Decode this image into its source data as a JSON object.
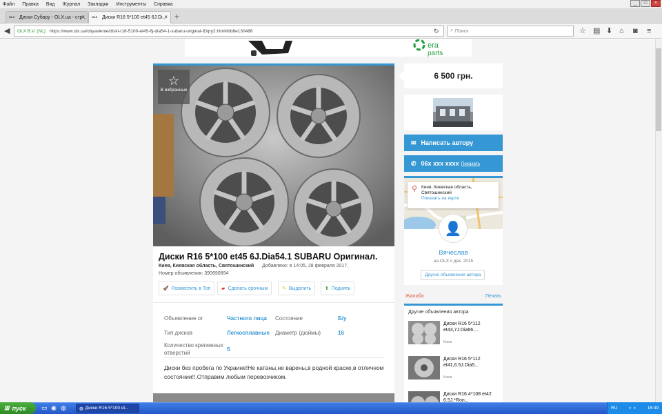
{
  "browser": {
    "menu": [
      "Файл",
      "Правка",
      "Вид",
      "Журнал",
      "Закладки",
      "Инструменты",
      "Справка"
    ],
    "tabs": [
      {
        "label": "Диски Субару - OLX.ua - стр...",
        "favicon": "OLX"
      },
      {
        "label": "Диски R16 5*100 et45 6J.Di...",
        "favicon": "OLX"
      }
    ],
    "site_identity": "OLX B.V. (NL)",
    "url": "https://www.olx.ua/obyavlenie/diski-r16-5100-et45-6j-dia54-1-subaru-original-IDqry2.html#bb8e130488",
    "search_placeholder": "Поиск"
  },
  "ad": {
    "favorite_label": "В избранные",
    "title": "Диски R16 5*100 et45 6J.Dia54.1 SUBARU Оригинал.",
    "location": "Киев, Киевская область, Святошинский",
    "added": "Добавлено: в 14:05, 28 февраля 2017,",
    "ad_number": "Номер объявления: 390690894",
    "actions": {
      "top": "Разместить в Топ",
      "urgent": "Сделать срочным",
      "highlight": "Выделить",
      "raise": "Поднять"
    },
    "params": [
      {
        "label": "Объявление от",
        "value": "Частного лица"
      },
      {
        "label": "Состояние",
        "value": "Б/у"
      },
      {
        "label": "Тип дисков",
        "value": "Легкосплавные"
      },
      {
        "label": "Диаметр (дюймы)",
        "value": "16"
      },
      {
        "label": "Количество крепежных отверстий",
        "value": "5"
      }
    ],
    "description": "Диски без пробега по Украине!Не катаны,не варены,в родной краске,в отличном состоянии!!.Отправим любым перевозчиком."
  },
  "sidebar": {
    "price": "6 500 грн.",
    "write_button": "Написать автору",
    "phone": "06x xxx xxxx",
    "phone_show": "Показать",
    "map_address": "Киев, Киевская область, Святошинский",
    "map_link": "Показать на карте",
    "seller_name": "Вячеслав",
    "seller_since": "на OLX с дек. 2015",
    "other_ads_button": "Другие объявления автора",
    "complain": "Жалоба",
    "print": "Печать",
    "other_ads_title": "Другие объявления автора",
    "other_ads": [
      {
        "title": "Диски R16 5*112 et43,7J.Dia66....",
        "city": "Киев"
      },
      {
        "title": "Диски R16 5*112 et41,6.5J.Dia5...",
        "city": "Киев"
      },
      {
        "title": "Диски R16 4*108 et42 6.5J.*Ron...",
        "city": ""
      }
    ]
  },
  "taskbar": {
    "start": "пуск",
    "task_item": "Диски R16 5*100 et...",
    "lang": "RU",
    "clock": "16:49"
  }
}
